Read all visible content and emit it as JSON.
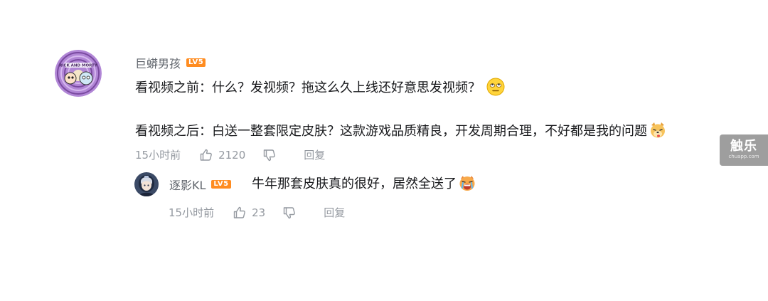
{
  "comment": {
    "username": "巨蟒男孩",
    "level": "LV5",
    "avatar_text": "RICK AND MORTY",
    "line1": "看视频之前：什么？发视频？拖这么久上线还好意思发视频？",
    "line2": "看视频之后：白送一整套限定皮肤？这款游戏品质精良，开发周期合理，不好都是我的问题",
    "time": "15小时前",
    "likes": "2120",
    "reply_label": "回复"
  },
  "reply": {
    "username": "逐影KL",
    "level": "LV5",
    "text": "牛年那套皮肤真的很好，居然全送了",
    "time": "15小时前",
    "likes": "23",
    "reply_label": "回复"
  },
  "watermark": {
    "brand": "触乐",
    "url": "chuapp.com"
  },
  "icons": {
    "emoji_1": "eye-roll-emoji-icon",
    "emoji_2": "dog-emoji-icon",
    "emoji_3": "crying-face-emoji-icon",
    "like": "thumbs-up-icon",
    "dislike": "thumbs-down-icon"
  },
  "colors": {
    "text": "#18191c",
    "username": "#61666d",
    "meta": "#9499a0",
    "level_badge": "#ff8c20"
  }
}
